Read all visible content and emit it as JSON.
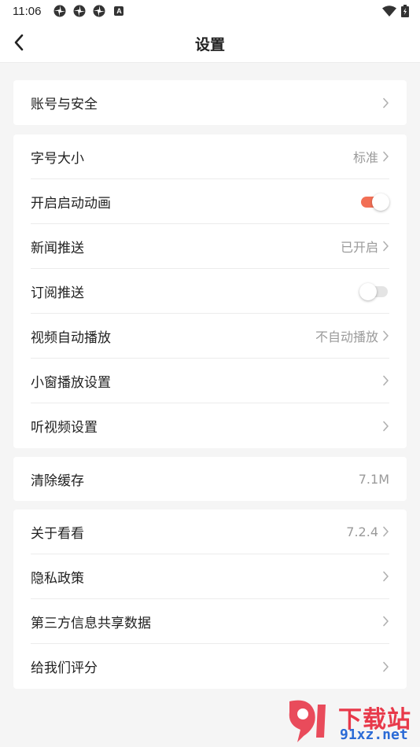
{
  "status_bar": {
    "time": "11:06",
    "notification_icons": [
      "pinwheel-icon",
      "pinwheel-icon",
      "pinwheel-icon"
    ],
    "badge_letter": "A",
    "right_icons": [
      "wifi-icon",
      "battery-charging-icon"
    ]
  },
  "header": {
    "title": "设置",
    "back_icon": "chevron-left-icon"
  },
  "sections": {
    "account": {
      "account_security": {
        "label": "账号与安全"
      }
    },
    "general": {
      "font_size": {
        "label": "字号大小",
        "value": "标准"
      },
      "startup_animation": {
        "label": "开启启动动画",
        "toggle": "on"
      },
      "news_push": {
        "label": "新闻推送",
        "value": "已开启"
      },
      "subscription_push": {
        "label": "订阅推送",
        "toggle": "off"
      },
      "video_autoplay": {
        "label": "视频自动播放",
        "value": "不自动播放"
      },
      "mini_window": {
        "label": "小窗播放设置"
      },
      "listen_video": {
        "label": "听视频设置"
      }
    },
    "cache": {
      "clear_cache": {
        "label": "清除缓存",
        "value": "7.1M"
      }
    },
    "about": {
      "about_app": {
        "label": "关于看看",
        "value": "7.2.4"
      },
      "privacy_policy": {
        "label": "隐私政策"
      },
      "third_party_sharing": {
        "label": "第三方信息共享数据"
      },
      "rate_us": {
        "label": "给我们评分"
      }
    }
  },
  "watermark": {
    "brand": "下载站",
    "url": "91xz.net"
  },
  "colors": {
    "accent": "#f26f55",
    "background": "#f5f5f5",
    "card": "#ffffff",
    "secondary_text": "#9a9a9a"
  }
}
